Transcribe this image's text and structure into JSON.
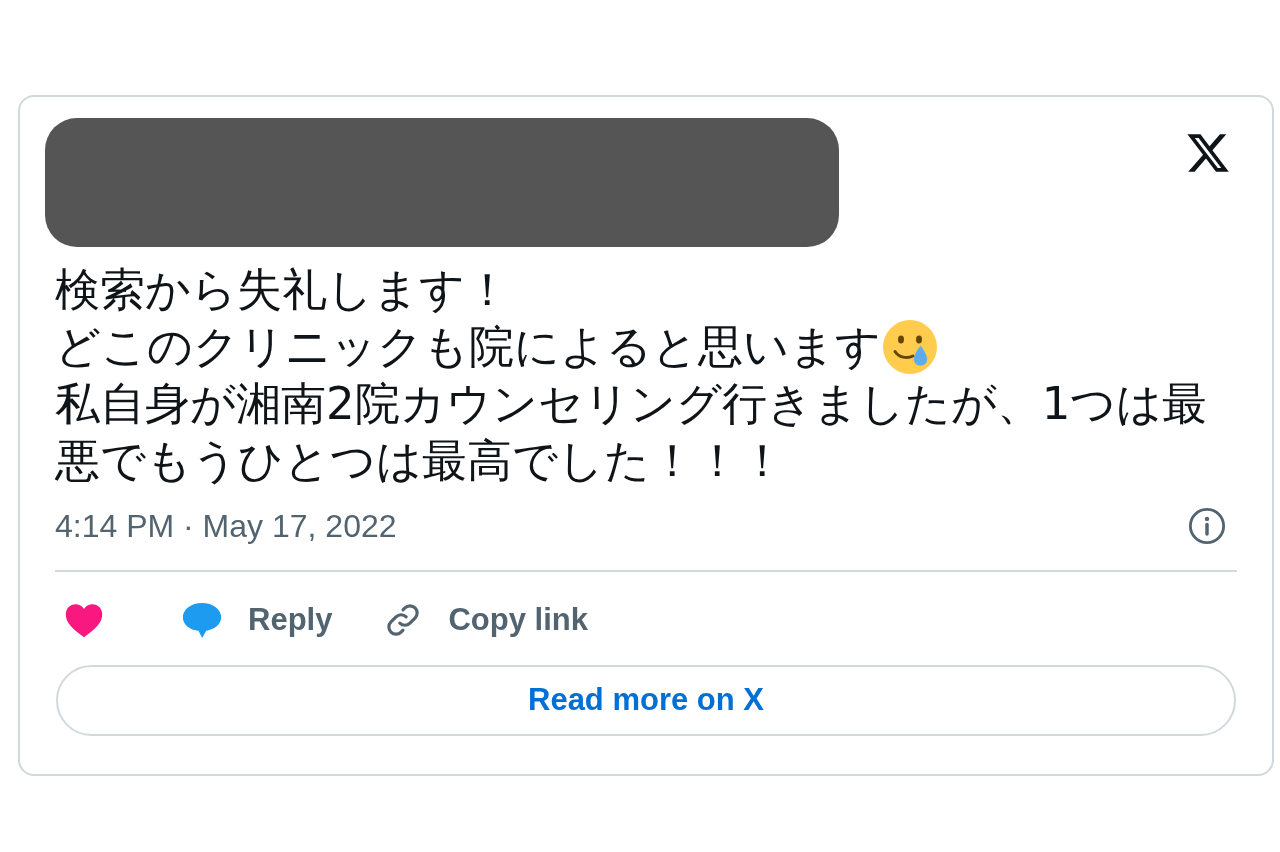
{
  "tweet": {
    "lines": [
      {
        "text": "検索から失礼します！",
        "trailing_emoji": false
      },
      {
        "text": "どこのクリニックも院によると思います",
        "trailing_emoji": true
      },
      {
        "text": "私自身が湘南2院カウンセリング行きましたが、1つは最",
        "trailing_emoji": false
      },
      {
        "text": "悪でもうひとつは最高でした！！！",
        "trailing_emoji": false
      }
    ],
    "timestamp": "4:14 PM · May 17, 2022"
  },
  "actions": [
    {
      "kind": "like"
    },
    {
      "kind": "reply",
      "label": "Reply"
    },
    {
      "kind": "copy_link",
      "label": "Copy link"
    }
  ],
  "read_more_button": {
    "label": "Read more on X"
  }
}
